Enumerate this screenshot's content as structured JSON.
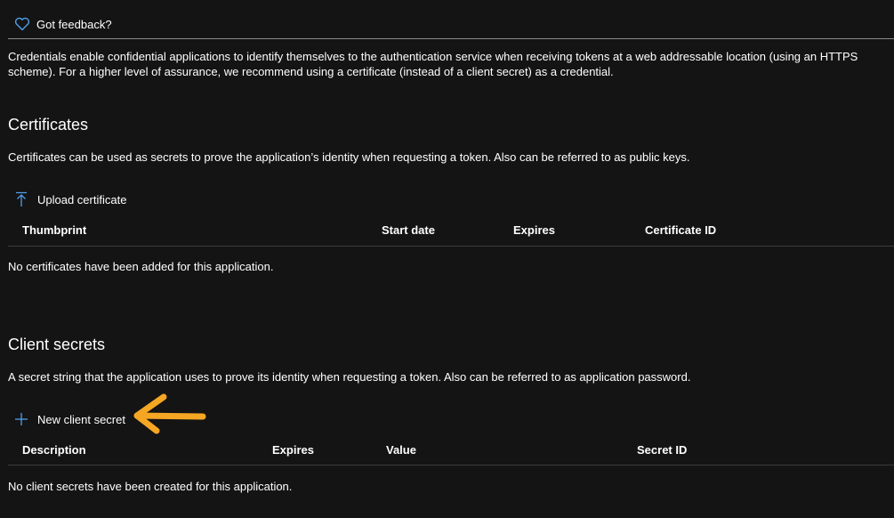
{
  "toolbar": {
    "feedback_label": "Got feedback?",
    "feedback_icon": "heart-icon"
  },
  "intro": {
    "text": "Credentials enable confidential applications to identify themselves to the authentication service when receiving tokens at a web addressable location (using an HTTPS scheme). For a higher level of assurance, we recommend using a certificate (instead of a client secret) as a credential."
  },
  "certificates": {
    "title": "Certificates",
    "description": "Certificates can be used as secrets to prove the application’s identity when requesting a token. Also can be referred to as public keys.",
    "upload_label": "Upload certificate",
    "upload_icon": "upload-icon",
    "columns": [
      "Thumbprint",
      "Start date",
      "Expires",
      "Certificate ID"
    ],
    "empty_text": "No certificates have been added for this application."
  },
  "client_secrets": {
    "title": "Client secrets",
    "description": "A secret string that the application uses to prove its identity when requesting a token. Also can be referred to as application password.",
    "new_label": "New client secret",
    "new_icon": "plus-icon",
    "columns": [
      "Description",
      "Expires",
      "Value",
      "Secret ID"
    ],
    "empty_text": "No client secrets have been created for this application."
  },
  "colors": {
    "background": "#141414",
    "accent_blue": "#4f9fe8",
    "annotation_arrow": "#f5a623"
  }
}
